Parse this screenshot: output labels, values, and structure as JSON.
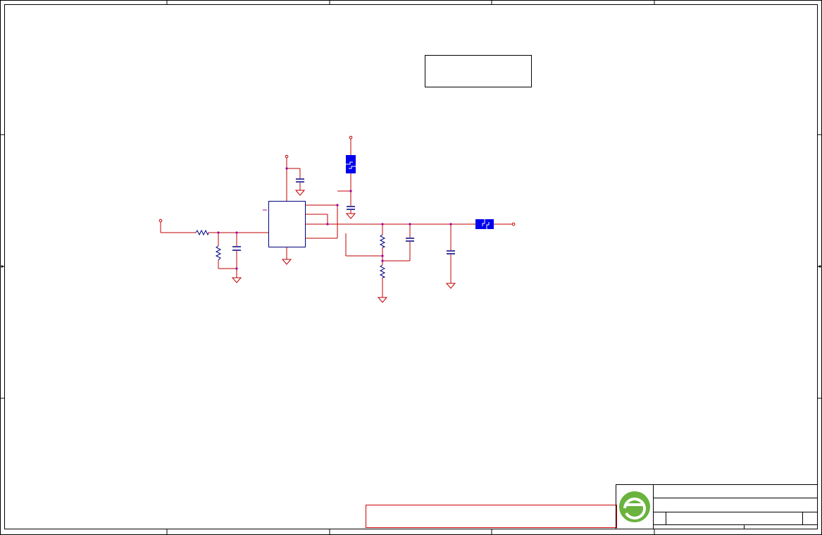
{
  "colors": {
    "frame": "#000000",
    "wire": "#c00000",
    "component": "#000080",
    "pin": "#a000a0",
    "ferrite": "#0000ee",
    "note_border": "#d00000",
    "logo_green": "#6ab33e"
  },
  "logo": {
    "icon": "company-logo-e-icon"
  }
}
